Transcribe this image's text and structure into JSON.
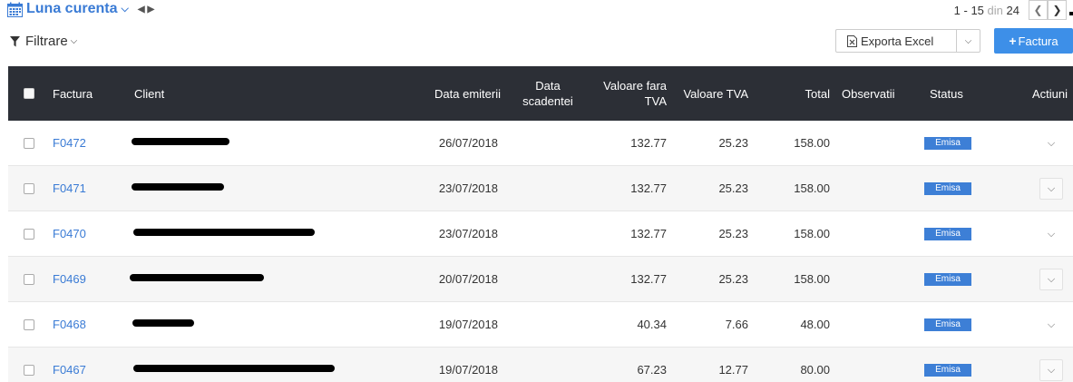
{
  "toolbar": {
    "period_label": "Luna curenta",
    "pager_range": "1 - 15",
    "pager_din": "din",
    "pager_total": "24",
    "filter_label": "Filtrare",
    "export_label": "Exporta Excel",
    "new_invoice_label": "Factura"
  },
  "table": {
    "headers": {
      "factura": "Factura",
      "client": "Client",
      "data_emiterii": "Data emiterii",
      "data_scadentei_1": "Data",
      "data_scadentei_2": "scadentei",
      "valoare_fara_tva_1": "Valoare fara",
      "valoare_fara_tva_2": "TVA",
      "valoare_tva": "Valoare TVA",
      "total": "Total",
      "observatii": "Observatii",
      "status": "Status",
      "actiuni": "Actiuni"
    },
    "rows": [
      {
        "factura": "F0472",
        "data_emiterii": "26/07/2018",
        "valoare_fara_tva": "132.77",
        "valoare_tva": "25.23",
        "total": "158.00",
        "status": "Emisa"
      },
      {
        "factura": "F0471",
        "data_emiterii": "23/07/2018",
        "valoare_fara_tva": "132.77",
        "valoare_tva": "25.23",
        "total": "158.00",
        "status": "Emisa"
      },
      {
        "factura": "F0470",
        "data_emiterii": "23/07/2018",
        "valoare_fara_tva": "132.77",
        "valoare_tva": "25.23",
        "total": "158.00",
        "status": "Emisa"
      },
      {
        "factura": "F0469",
        "data_emiterii": "20/07/2018",
        "valoare_fara_tva": "132.77",
        "valoare_tva": "25.23",
        "total": "158.00",
        "status": "Emisa"
      },
      {
        "factura": "F0468",
        "data_emiterii": "19/07/2018",
        "valoare_fara_tva": "40.34",
        "valoare_tva": "7.66",
        "total": "48.00",
        "status": "Emisa"
      },
      {
        "factura": "F0467",
        "data_emiterii": "19/07/2018",
        "valoare_fara_tva": "67.23",
        "valoare_tva": "12.77",
        "total": "80.00",
        "status": "Emisa"
      }
    ]
  },
  "colors": {
    "accent": "#3a7bd5",
    "header_bg": "#2c2f36",
    "status_badge": "#3d7fd6",
    "primary_button": "#3d8fe8"
  },
  "icons": {
    "period": "calendar-icon",
    "filter": "funnel-icon",
    "export": "excel-icon",
    "row_action": "chevron-down-icon"
  }
}
